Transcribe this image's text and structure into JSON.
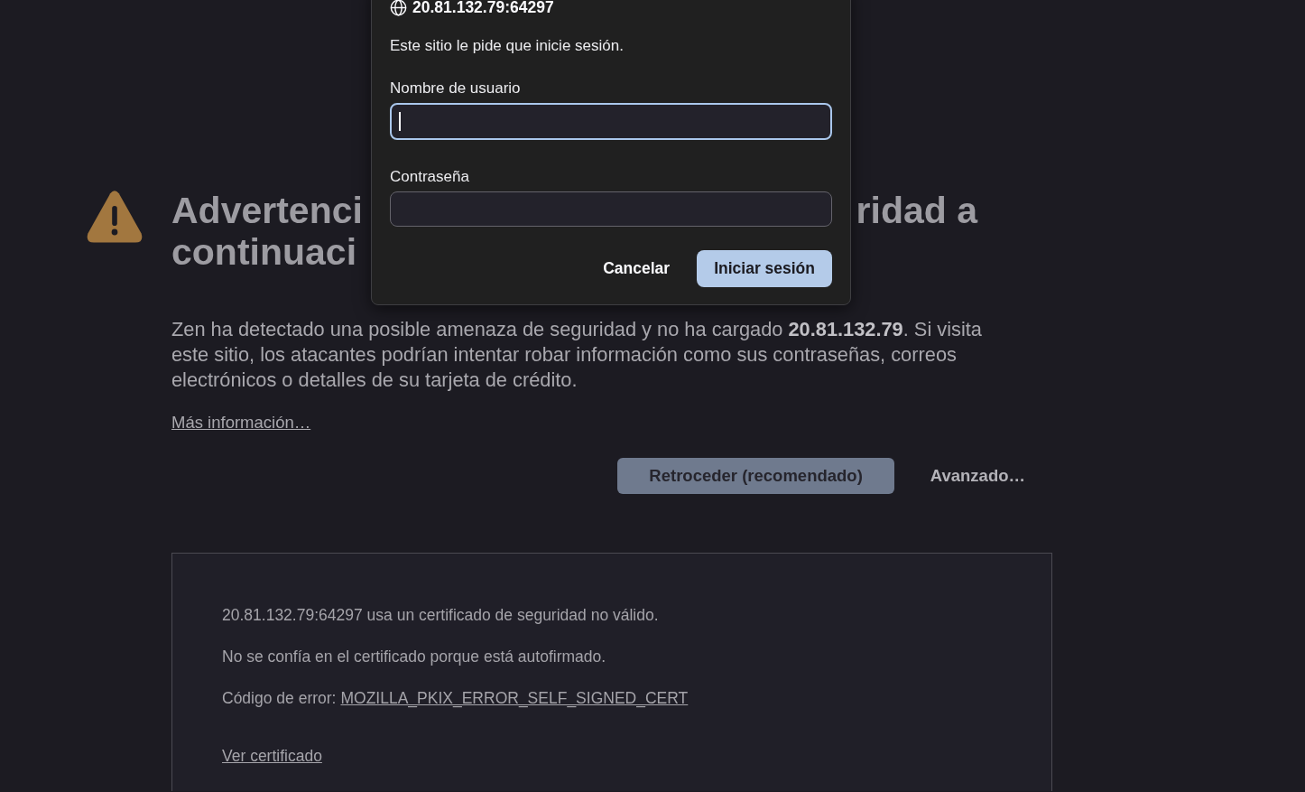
{
  "dialog": {
    "title": "20.81.132.79:64297",
    "message": "Este sitio le pide que inicie sesión.",
    "fields": [
      {
        "label": "Nombre de usuario",
        "focused": true
      },
      {
        "label": "Contraseña",
        "focused": false
      }
    ],
    "buttons": [
      {
        "label": "Cancelar",
        "kind": "secondary"
      },
      {
        "label": "Iniciar sesión",
        "kind": "primary"
      }
    ]
  },
  "page": {
    "heading_lines": [
      {
        "left": "Advertenci",
        "right": "ridad a"
      },
      {
        "left": "continuaci"
      }
    ],
    "description": "Zen ha detectado una posible amenaza de seguridad y no ha cargado **20.81.132.79**. Si visita este sitio, los atacantes podrían intentar robar información como sus contraseñas, correos electrónicos o detalles de su tarjeta de crédito.",
    "learn_more_link": "Más información…",
    "buttons": [
      {
        "label": "Retroceder (recomendado)",
        "kind": "primary"
      },
      {
        "label": "Avanzado…",
        "kind": "secondary"
      }
    ],
    "advanced_panel": {
      "lines": [
        "20.81.132.79:64297 usa un certificado de seguridad no válido.",
        "No se confía en el certificado porque está autofirmado."
      ],
      "error_code_label": "Código de error:",
      "error_code": "MOZILLA_PKIX_ERROR_SELF_SIGNED_CERT",
      "view_certificate_link": "Ver certificado"
    }
  }
}
